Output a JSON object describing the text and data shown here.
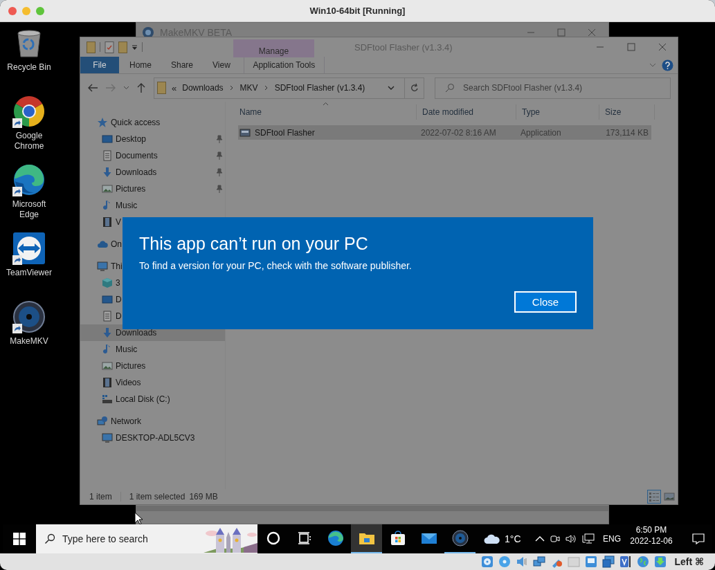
{
  "host_window": {
    "title": "Win10-64bit [Running]"
  },
  "desktop_icons": [
    {
      "label": "Recycle Bin",
      "kind": "recycle",
      "shortcut": false
    },
    {
      "label": "Google Chrome",
      "kind": "chrome",
      "shortcut": true
    },
    {
      "label": "Microsoft Edge",
      "kind": "edge",
      "shortcut": true
    },
    {
      "label": "TeamViewer",
      "kind": "teamviewer",
      "shortcut": true
    },
    {
      "label": "MakeMKV",
      "kind": "makemkv",
      "shortcut": true
    }
  ],
  "background_window": {
    "title": "MakeMKV BETA"
  },
  "explorer": {
    "title": "SDFtool Flasher (v1.3.4)",
    "context_tab": "Manage",
    "ribbon_tabs": [
      {
        "label": "File",
        "kind": "backstage"
      },
      {
        "label": "Home",
        "kind": "tab"
      },
      {
        "label": "Share",
        "kind": "tab"
      },
      {
        "label": "View",
        "kind": "tab"
      },
      {
        "label": "Application Tools",
        "kind": "contextual"
      }
    ],
    "breadcrumb_overflow": "«",
    "breadcrumb": [
      "Downloads",
      "MKV",
      "SDFtool Flasher (v1.3.4)"
    ],
    "search": {
      "placeholder": "Search SDFtool Flasher (v1.3.4)"
    },
    "nav": [
      {
        "label": "Quick access",
        "selected": false,
        "children": [
          {
            "label": "Desktop",
            "selected": false,
            "pinned": true
          },
          {
            "label": "Documents",
            "selected": false,
            "pinned": true
          },
          {
            "label": "Downloads",
            "selected": false,
            "pinned": true
          },
          {
            "label": "Pictures",
            "selected": false,
            "pinned": true
          },
          {
            "label": "Music",
            "selected": false,
            "pinned": false
          },
          {
            "label": "V",
            "selected": false,
            "pinned": false
          }
        ]
      },
      {
        "label": "On",
        "selected": false
      },
      {
        "label": "Thi",
        "selected": false,
        "children": [
          {
            "label": "3",
            "selected": false,
            "pinned": false
          },
          {
            "label": "D",
            "selected": false,
            "pinned": false
          },
          {
            "label": "D",
            "selected": false,
            "pinned": false
          },
          {
            "label": "Downloads",
            "selected": true,
            "pinned": false
          },
          {
            "label": "Music",
            "selected": false,
            "pinned": false
          },
          {
            "label": "Pictures",
            "selected": false,
            "pinned": false
          },
          {
            "label": "Videos",
            "selected": false,
            "pinned": false
          },
          {
            "label": "Local Disk (C:)",
            "selected": false,
            "pinned": false
          }
        ]
      },
      {
        "label": "Network",
        "selected": false,
        "children": [
          {
            "label": "DESKTOP-ADL5CV3",
            "selected": false,
            "pinned": false
          }
        ]
      }
    ],
    "columns": [
      "Name",
      "Date modified",
      "Type",
      "Size"
    ],
    "rows": [
      {
        "cells": [
          "SDFtool Flasher",
          "2022-07-02 8:16 AM",
          "Application",
          "173,114 KB"
        ],
        "selected": true
      }
    ],
    "status_bar": {
      "item_count": "1 item",
      "selection": "1 item selected",
      "selection_size": "169 MB"
    },
    "view_buttons": [
      {
        "kind": "details",
        "selected": true
      },
      {
        "kind": "large-icons",
        "selected": false
      }
    ]
  },
  "dialog": {
    "title": "This app can’t run on your PC",
    "message": "To find a version for your PC, check with the software publisher.",
    "button": "Close"
  },
  "taskbar": {
    "search_placeholder": "Type here to search",
    "apps": [
      {
        "kind": "cortana",
        "active": false,
        "running": false
      },
      {
        "kind": "taskview",
        "active": false,
        "running": false
      },
      {
        "kind": "edge",
        "active": false,
        "running": false
      },
      {
        "kind": "explorer",
        "active": true,
        "running": true
      },
      {
        "kind": "store",
        "active": false,
        "running": false
      },
      {
        "kind": "mail",
        "active": false,
        "running": false
      },
      {
        "kind": "makemkv",
        "active": false,
        "running": true
      }
    ],
    "weather": "1°C",
    "language": "ENG",
    "time": "6:50 PM",
    "date": "2022-12-06"
  },
  "vm_status": {
    "host_key": "Left ⌘"
  }
}
